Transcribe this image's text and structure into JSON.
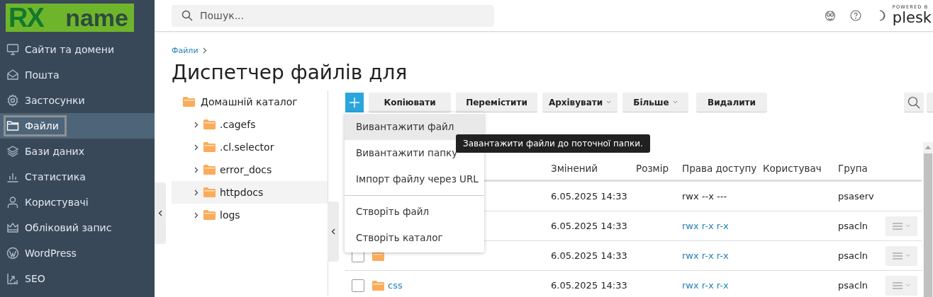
{
  "logo": {
    "mark": "RX",
    "text": "name"
  },
  "sidebar": {
    "items": [
      {
        "label": "Сайти та домени",
        "selected": false
      },
      {
        "label": "Пошта",
        "selected": false
      },
      {
        "label": "Застосунки",
        "selected": false
      },
      {
        "label": "Файли",
        "selected": true
      },
      {
        "label": "Бази даних",
        "selected": false
      },
      {
        "label": "Статистика",
        "selected": false
      },
      {
        "label": "Користувачі",
        "selected": false
      },
      {
        "label": "Обліковий запис",
        "selected": false
      },
      {
        "label": "WordPress",
        "selected": false
      },
      {
        "label": "SEO",
        "selected": false
      }
    ]
  },
  "search": {
    "placeholder": "Пошук..."
  },
  "brand": {
    "powered_by": "POWERED B",
    "name": "plesk"
  },
  "breadcrumb": [
    {
      "label": "Файли"
    }
  ],
  "title": "Диспетчер файлів для",
  "tree": {
    "label": "Домашній каталог",
    "children": [
      {
        "label": ".cagefs",
        "expanded": false,
        "selected": false
      },
      {
        "label": ".cl.selector",
        "expanded": false,
        "selected": false
      },
      {
        "label": "error_docs",
        "expanded": false,
        "selected": false
      },
      {
        "label": "httpdocs",
        "expanded": false,
        "selected": true
      },
      {
        "label": "logs",
        "expanded": false,
        "selected": false
      }
    ]
  },
  "toolbar": {
    "buttons": [
      {
        "label": "Копіювати",
        "dropdown": false
      },
      {
        "label": "Перемістити",
        "dropdown": false
      },
      {
        "label": "Архівувати",
        "dropdown": true
      },
      {
        "label": "Більше",
        "dropdown": true
      },
      {
        "label": "Видалити",
        "dropdown": false
      }
    ]
  },
  "table": {
    "columns": [
      "Змінений",
      "Розмір",
      "Права доступу",
      "Користувач",
      "Група"
    ],
    "rows": [
      {
        "modified": "6.05.2025 14:33",
        "permissions": "rwx --x ---",
        "permissions_link": false,
        "group": "psaserv",
        "actions": false
      },
      {
        "modified": "6.05.2025 14:33",
        "permissions": "rwx r-x r-x",
        "permissions_link": true,
        "group": "psacln",
        "actions": true
      },
      {
        "kind": "folder",
        "checked": false,
        "modified": "6.05.2025 14:33",
        "permissions": "rwx r-x r-x",
        "permissions_link": true,
        "group": "psacln",
        "actions": true
      },
      {
        "kind": "folder",
        "checked": false,
        "name": "css",
        "modified": "6.05.2025 14:33",
        "permissions": "rwx r-x r-x",
        "permissions_link": true,
        "group": "psacln",
        "actions": true
      }
    ]
  },
  "add_menu": {
    "sections": [
      {
        "items": [
          {
            "label": "Вивантажити файл",
            "selected": true
          },
          {
            "label": "Вивантажити папку",
            "selected": false
          },
          {
            "label": "Імпорт файлу через URL",
            "selected": false
          }
        ]
      },
      {
        "items": [
          {
            "label": "Створіть файл",
            "selected": false
          },
          {
            "label": "Створіть каталог",
            "selected": false
          }
        ]
      }
    ]
  },
  "tooltip": "Завантажити файли до поточної папки."
}
